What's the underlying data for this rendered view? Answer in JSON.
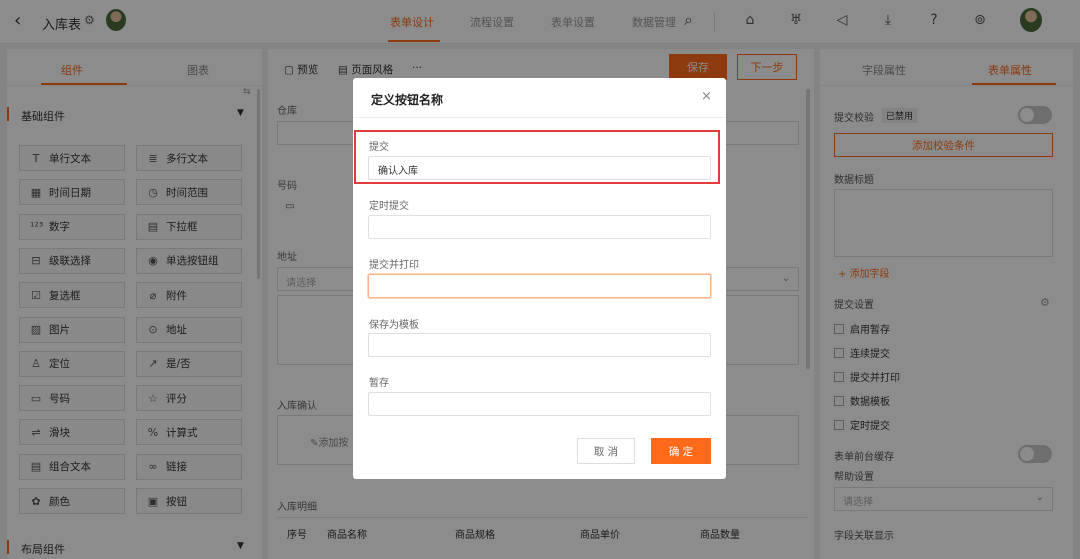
{
  "header": {
    "back_icon": "chevron-left-icon",
    "title": "入库表",
    "nav_tabs": [
      "表单设计",
      "流程设置",
      "表单设置",
      "数据管理"
    ],
    "active_tab": 0,
    "icons": [
      "search-icon",
      "home-icon",
      "shirt-icon",
      "megaphone-icon",
      "download-icon",
      "help-icon",
      "settings-icon"
    ]
  },
  "left_panel": {
    "tabs": [
      "组件",
      "图表"
    ],
    "group_basic": "基础组件",
    "components": [
      {
        "icon": "T",
        "label": "单行文本"
      },
      {
        "icon": "≣",
        "label": "多行文本"
      },
      {
        "icon": "▦",
        "label": "时间日期"
      },
      {
        "icon": "◷",
        "label": "时间范围"
      },
      {
        "icon": "¹²³",
        "label": "数字"
      },
      {
        "icon": "▤",
        "label": "下拉框"
      },
      {
        "icon": "⊟",
        "label": "级联选择"
      },
      {
        "icon": "◉",
        "label": "单选按钮组"
      },
      {
        "icon": "☑",
        "label": "复选框"
      },
      {
        "icon": "⌀",
        "label": "附件"
      },
      {
        "icon": "▨",
        "label": "图片"
      },
      {
        "icon": "⊙",
        "label": "地址"
      },
      {
        "icon": "♙",
        "label": "定位"
      },
      {
        "icon": "↗",
        "label": "是/否"
      },
      {
        "icon": "▭",
        "label": "号码"
      },
      {
        "icon": "☆",
        "label": "评分"
      },
      {
        "icon": "⇌",
        "label": "滑块"
      },
      {
        "icon": "%",
        "label": "计算式"
      },
      {
        "icon": "▤",
        "label": "组合文本"
      },
      {
        "icon": "∞",
        "label": "链接"
      },
      {
        "icon": "✿",
        "label": "颜色"
      },
      {
        "icon": "▣",
        "label": "按钮"
      }
    ],
    "group_layout": "布局组件"
  },
  "canvas": {
    "toolbar": {
      "preview": "预览",
      "page_style": "页面风格",
      "more": "···"
    },
    "save": "保存",
    "next": "下一步",
    "fields": {
      "warehouse": "仓库",
      "number": "号码",
      "address": "地址",
      "address_placeholder": "请选择",
      "confirm": "入库确认",
      "add_button_partial": "添加按"
    },
    "detail": {
      "title": "入库明细",
      "columns": [
        "序号",
        "商品名称",
        "商品规格",
        "商品单价",
        "商品数量"
      ]
    }
  },
  "right_panel": {
    "tabs": [
      "字段属性",
      "表单属性"
    ],
    "submit_validation": "提交校验",
    "disabled_badge": "已禁用",
    "add_rule": "添加校验条件",
    "data_title": "数据标题",
    "add_field": "添加字段",
    "submit_settings": "提交设置",
    "checkboxes": [
      "启用暂存",
      "连续提交",
      "提交并打印",
      "数据模板",
      "定时提交"
    ],
    "front_cache": "表单前台缓存",
    "help_settings": "帮助设置",
    "help_placeholder": "请选择",
    "field_link": "字段关联显示"
  },
  "dialog": {
    "title": "定义按钮名称",
    "fields": [
      {
        "label": "提交",
        "value": "确认入库"
      },
      {
        "label": "定时提交",
        "value": ""
      },
      {
        "label": "提交并打印",
        "value": ""
      },
      {
        "label": "保存为模板",
        "value": ""
      },
      {
        "label": "暂存",
        "value": ""
      }
    ],
    "cancel": "取 消",
    "confirm": "确 定"
  },
  "colors": {
    "accent": "#ff6a1a",
    "highlight": "#e23b3b"
  }
}
